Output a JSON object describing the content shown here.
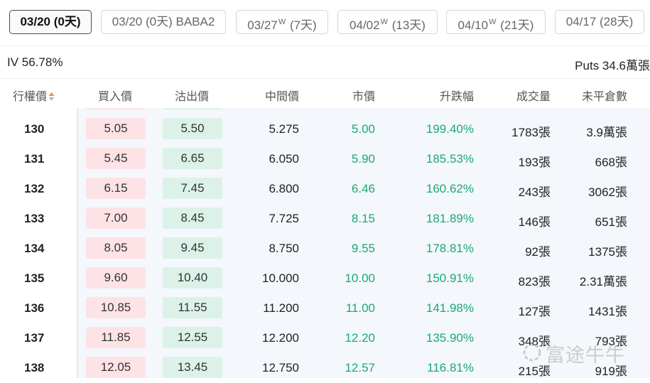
{
  "tabs": [
    {
      "date": "03/20",
      "w": "",
      "days": "(0天)",
      "extra": "",
      "active": true
    },
    {
      "date": "03/20",
      "w": "",
      "days": "(0天)",
      "extra": "BABA2",
      "active": false
    },
    {
      "date": "03/27",
      "w": "W",
      "days": "(7天)",
      "extra": "",
      "active": false
    },
    {
      "date": "04/02",
      "w": "W",
      "days": "(13天)",
      "extra": "",
      "active": false
    },
    {
      "date": "04/10",
      "w": "W",
      "days": "(21天)",
      "extra": "",
      "active": false
    },
    {
      "date": "04/17",
      "w": "",
      "days": "(28天)",
      "extra": "",
      "active": false
    }
  ],
  "info": {
    "iv": "IV 56.78%",
    "puts": "Puts 34.6萬張"
  },
  "columns": {
    "strike": "行權價",
    "bid": "買入價",
    "ask": "沽出價",
    "mid": "中間價",
    "last": "市價",
    "change": "升跌幅",
    "volume": "成交量",
    "open_interest": "未平倉數"
  },
  "rows": [
    {
      "strike": "130",
      "bid": "5.05",
      "ask": "5.50",
      "mid": "5.275",
      "last": "5.00",
      "change": "199.40%",
      "volume": "1783張",
      "oi": "3.9萬張"
    },
    {
      "strike": "131",
      "bid": "5.45",
      "ask": "6.65",
      "mid": "6.050",
      "last": "5.90",
      "change": "185.53%",
      "volume": "193張",
      "oi": "668張"
    },
    {
      "strike": "132",
      "bid": "6.15",
      "ask": "7.45",
      "mid": "6.800",
      "last": "6.46",
      "change": "160.62%",
      "volume": "243張",
      "oi": "3062張"
    },
    {
      "strike": "133",
      "bid": "7.00",
      "ask": "8.45",
      "mid": "7.725",
      "last": "8.15",
      "change": "181.89%",
      "volume": "146張",
      "oi": "651張"
    },
    {
      "strike": "134",
      "bid": "8.05",
      "ask": "9.45",
      "mid": "8.750",
      "last": "9.55",
      "change": "178.81%",
      "volume": "92張",
      "oi": "1375張"
    },
    {
      "strike": "135",
      "bid": "9.60",
      "ask": "10.40",
      "mid": "10.000",
      "last": "10.00",
      "change": "150.91%",
      "volume": "823張",
      "oi": "2.31萬張"
    },
    {
      "strike": "136",
      "bid": "10.85",
      "ask": "11.55",
      "mid": "11.200",
      "last": "11.00",
      "change": "141.98%",
      "volume": "127張",
      "oi": "1431張"
    },
    {
      "strike": "137",
      "bid": "11.85",
      "ask": "12.55",
      "mid": "12.200",
      "last": "12.20",
      "change": "135.90%",
      "volume": "348張",
      "oi": "793張"
    },
    {
      "strike": "138",
      "bid": "12.05",
      "ask": "13.45",
      "mid": "12.750",
      "last": "12.57",
      "change": "116.81%",
      "volume": "215張",
      "oi": "919張"
    }
  ],
  "colors": {
    "up": "#1aaa75",
    "bid_bg": "#fde3e6",
    "ask_bg": "#dcf2e8"
  },
  "watermark": "富途牛牛"
}
